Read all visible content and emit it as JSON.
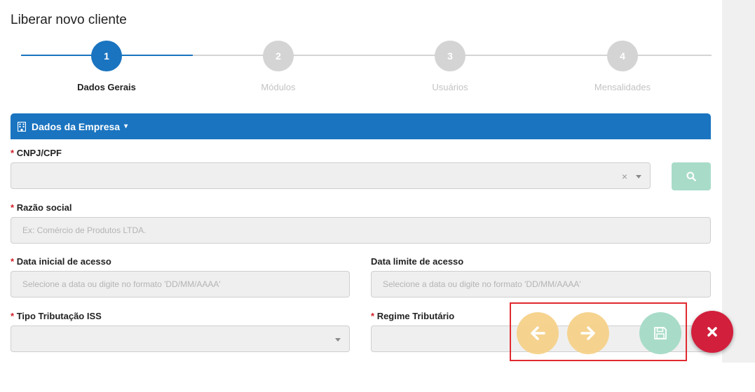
{
  "page": {
    "title": "Liberar novo cliente"
  },
  "stepper": {
    "steps": [
      {
        "number": "1",
        "label": "Dados Gerais",
        "state": "active"
      },
      {
        "number": "2",
        "label": "Módulos",
        "state": "inactive"
      },
      {
        "number": "3",
        "label": "Usuários",
        "state": "inactive"
      },
      {
        "number": "4",
        "label": "Mensalidades",
        "state": "inactive"
      }
    ]
  },
  "section": {
    "title": "Dados da Empresa",
    "icon": "building-icon"
  },
  "form": {
    "required_mark": "*",
    "cnpj": {
      "label": "CNPJ/CPF",
      "value": ""
    },
    "razao_social": {
      "label": "Razão social",
      "placeholder": "Ex: Comércio de Produtos LTDA."
    },
    "data_inicial": {
      "label": "Data inicial de acesso",
      "placeholder": "Selecione a data ou digite no formato 'DD/MM/AAAA'"
    },
    "data_limite": {
      "label": "Data limite de acesso",
      "placeholder": "Selecione a data ou digite no formato 'DD/MM/AAAA'"
    },
    "tipo_tributacao": {
      "label": "Tipo Tributação ISS",
      "value": ""
    },
    "regime_tributario": {
      "label": "Regime Tributário",
      "value": ""
    }
  },
  "actions": {
    "search": {
      "icon": "search-icon"
    },
    "previous": {
      "icon": "arrow-left-icon"
    },
    "next": {
      "icon": "arrow-right-icon"
    },
    "save": {
      "icon": "floppy-disk-icon"
    },
    "close": {
      "icon": "close-icon"
    }
  },
  "colors": {
    "primary": "#1a74c0",
    "inactive_step": "#d4d4d4",
    "required": "#d0202a",
    "fab_nav": "#f6d28a",
    "fab_save": "#a8dcc8",
    "fab_close": "#d21f3c",
    "highlight": "#e02a2f"
  }
}
